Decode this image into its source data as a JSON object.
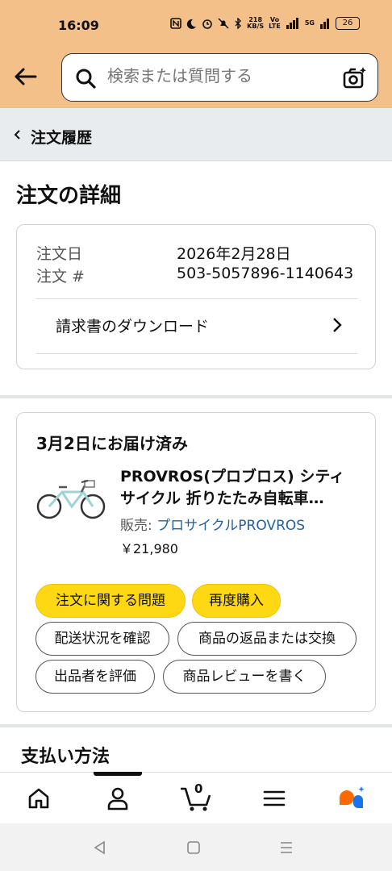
{
  "status_bar": {
    "time": "16:09",
    "net_speed_top": "218",
    "net_speed_unit": "KB/S",
    "network_top": "Vo",
    "network_bottom": "LTE",
    "network_type": "5G",
    "battery": "26"
  },
  "search": {
    "placeholder": "検索または質問する"
  },
  "breadcrumb": {
    "label": "注文履歴"
  },
  "page_title": "注文の詳細",
  "order_info": {
    "date_label": "注文日",
    "date_value": "2026年2月28日",
    "number_label": "注文 #",
    "number_value": "503-5057896-1140643",
    "invoice_label": "請求書のダウンロード"
  },
  "shipment": {
    "status": "3月2日にお届け済み",
    "product_title_line1": "PROVROS(プロブロス) シティ",
    "product_title_line2": "サイクル 折りたたみ自転車…",
    "seller_prefix": "販売: ",
    "seller_name": "プロサイクルPROVROS",
    "price": "￥21,980",
    "buttons": {
      "problem": "注文に関する問題",
      "rebuy": "再度購入",
      "track": "配送状況を確認",
      "return": "商品の返品または交換",
      "rate_seller": "出品者を評価",
      "review": "商品レビューを書く"
    }
  },
  "payment": {
    "title": "支払い方法"
  },
  "bottom_nav": {
    "cart_count": "0"
  },
  "colors": {
    "header_bg": "#f4c08a",
    "yellow_button": "#ffd814",
    "link": "#2162a1",
    "breadcrumb_bg": "#e9ecee",
    "assistant_orange": "#ff6a00",
    "assistant_blue": "#1a73e8"
  }
}
